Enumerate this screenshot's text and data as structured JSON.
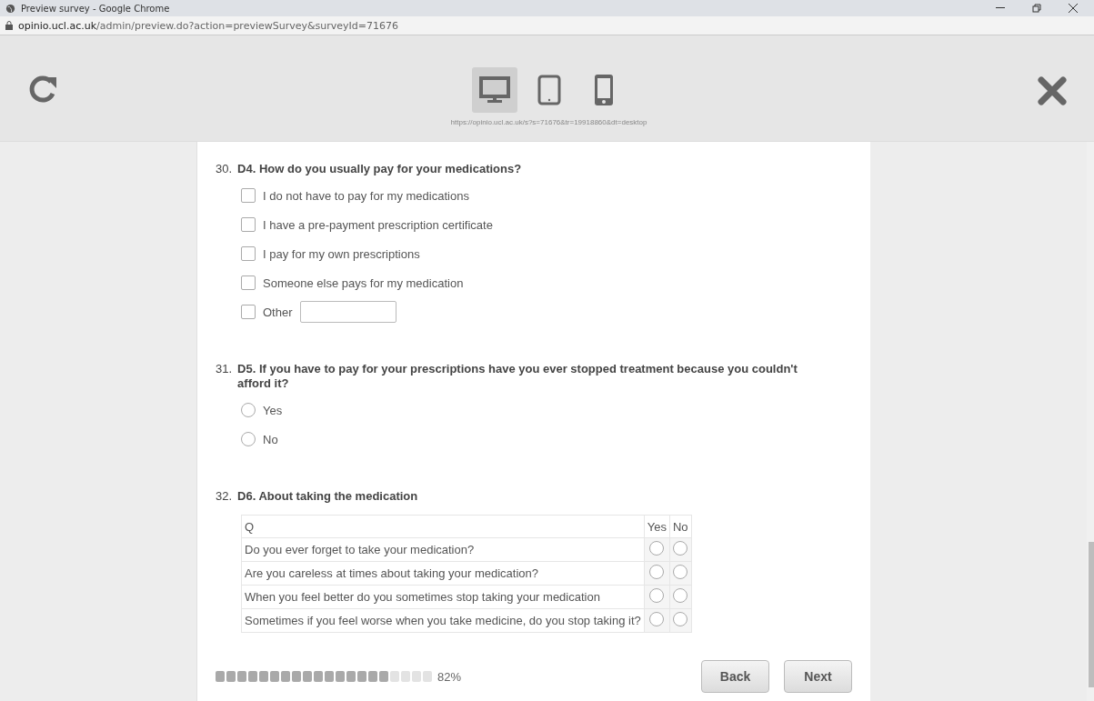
{
  "window": {
    "title": "Preview survey - Google Chrome"
  },
  "address_bar": {
    "host": "opinio.ucl.ac.uk",
    "path": "/admin/preview.do?action=previewSurvey&surveyId=71676"
  },
  "preview_toolbar": {
    "devices": [
      {
        "kind": "desktop",
        "selected": true
      },
      {
        "kind": "tablet",
        "selected": false
      },
      {
        "kind": "phone",
        "selected": false
      }
    ],
    "url": "https://opinio.ucl.ac.uk/s?s=71676&tr=19918860&dt=desktop"
  },
  "questions": [
    {
      "kind": "checkbox",
      "number": "30.",
      "title": "D4. How do you usually pay for your medications?",
      "options": [
        {
          "kind": "plain",
          "label": "I do not have to pay for my medications",
          "checked": false
        },
        {
          "kind": "plain",
          "label": "I have a pre-payment prescription certificate",
          "checked": false
        },
        {
          "kind": "plain",
          "label": "I pay for my own prescriptions",
          "checked": false
        },
        {
          "kind": "plain",
          "label": "Someone else pays for my medication",
          "checked": false
        },
        {
          "kind": "with_field",
          "label": "Other",
          "checked": false
        }
      ]
    },
    {
      "kind": "radio",
      "number": "31.",
      "title": "D5. If you have to pay for your prescriptions have you ever stopped treatment because you couldn't afford it?",
      "options": [
        {
          "label": "Yes",
          "selected": false
        },
        {
          "label": "No",
          "selected": false
        }
      ]
    },
    {
      "kind": "matrix",
      "number": "32.",
      "title": "D6. About taking the medication",
      "columns": [
        "Q",
        "Yes",
        "No"
      ],
      "rows": [
        {
          "label": "Do you ever forget to take your medication?",
          "answers": [
            false,
            false
          ]
        },
        {
          "label": "Are you careless at times about taking your medication?",
          "answers": [
            false,
            false
          ]
        },
        {
          "label": "When you feel better do you sometimes stop taking your medication",
          "answers": [
            false,
            false
          ]
        },
        {
          "label": "Sometimes if you feel worse when you take medicine, do you stop taking it?",
          "answers": [
            false,
            false
          ]
        }
      ]
    }
  ],
  "progress": {
    "level": 0.82,
    "reading": "82%"
  },
  "buttons": [
    "Back",
    "Next"
  ]
}
